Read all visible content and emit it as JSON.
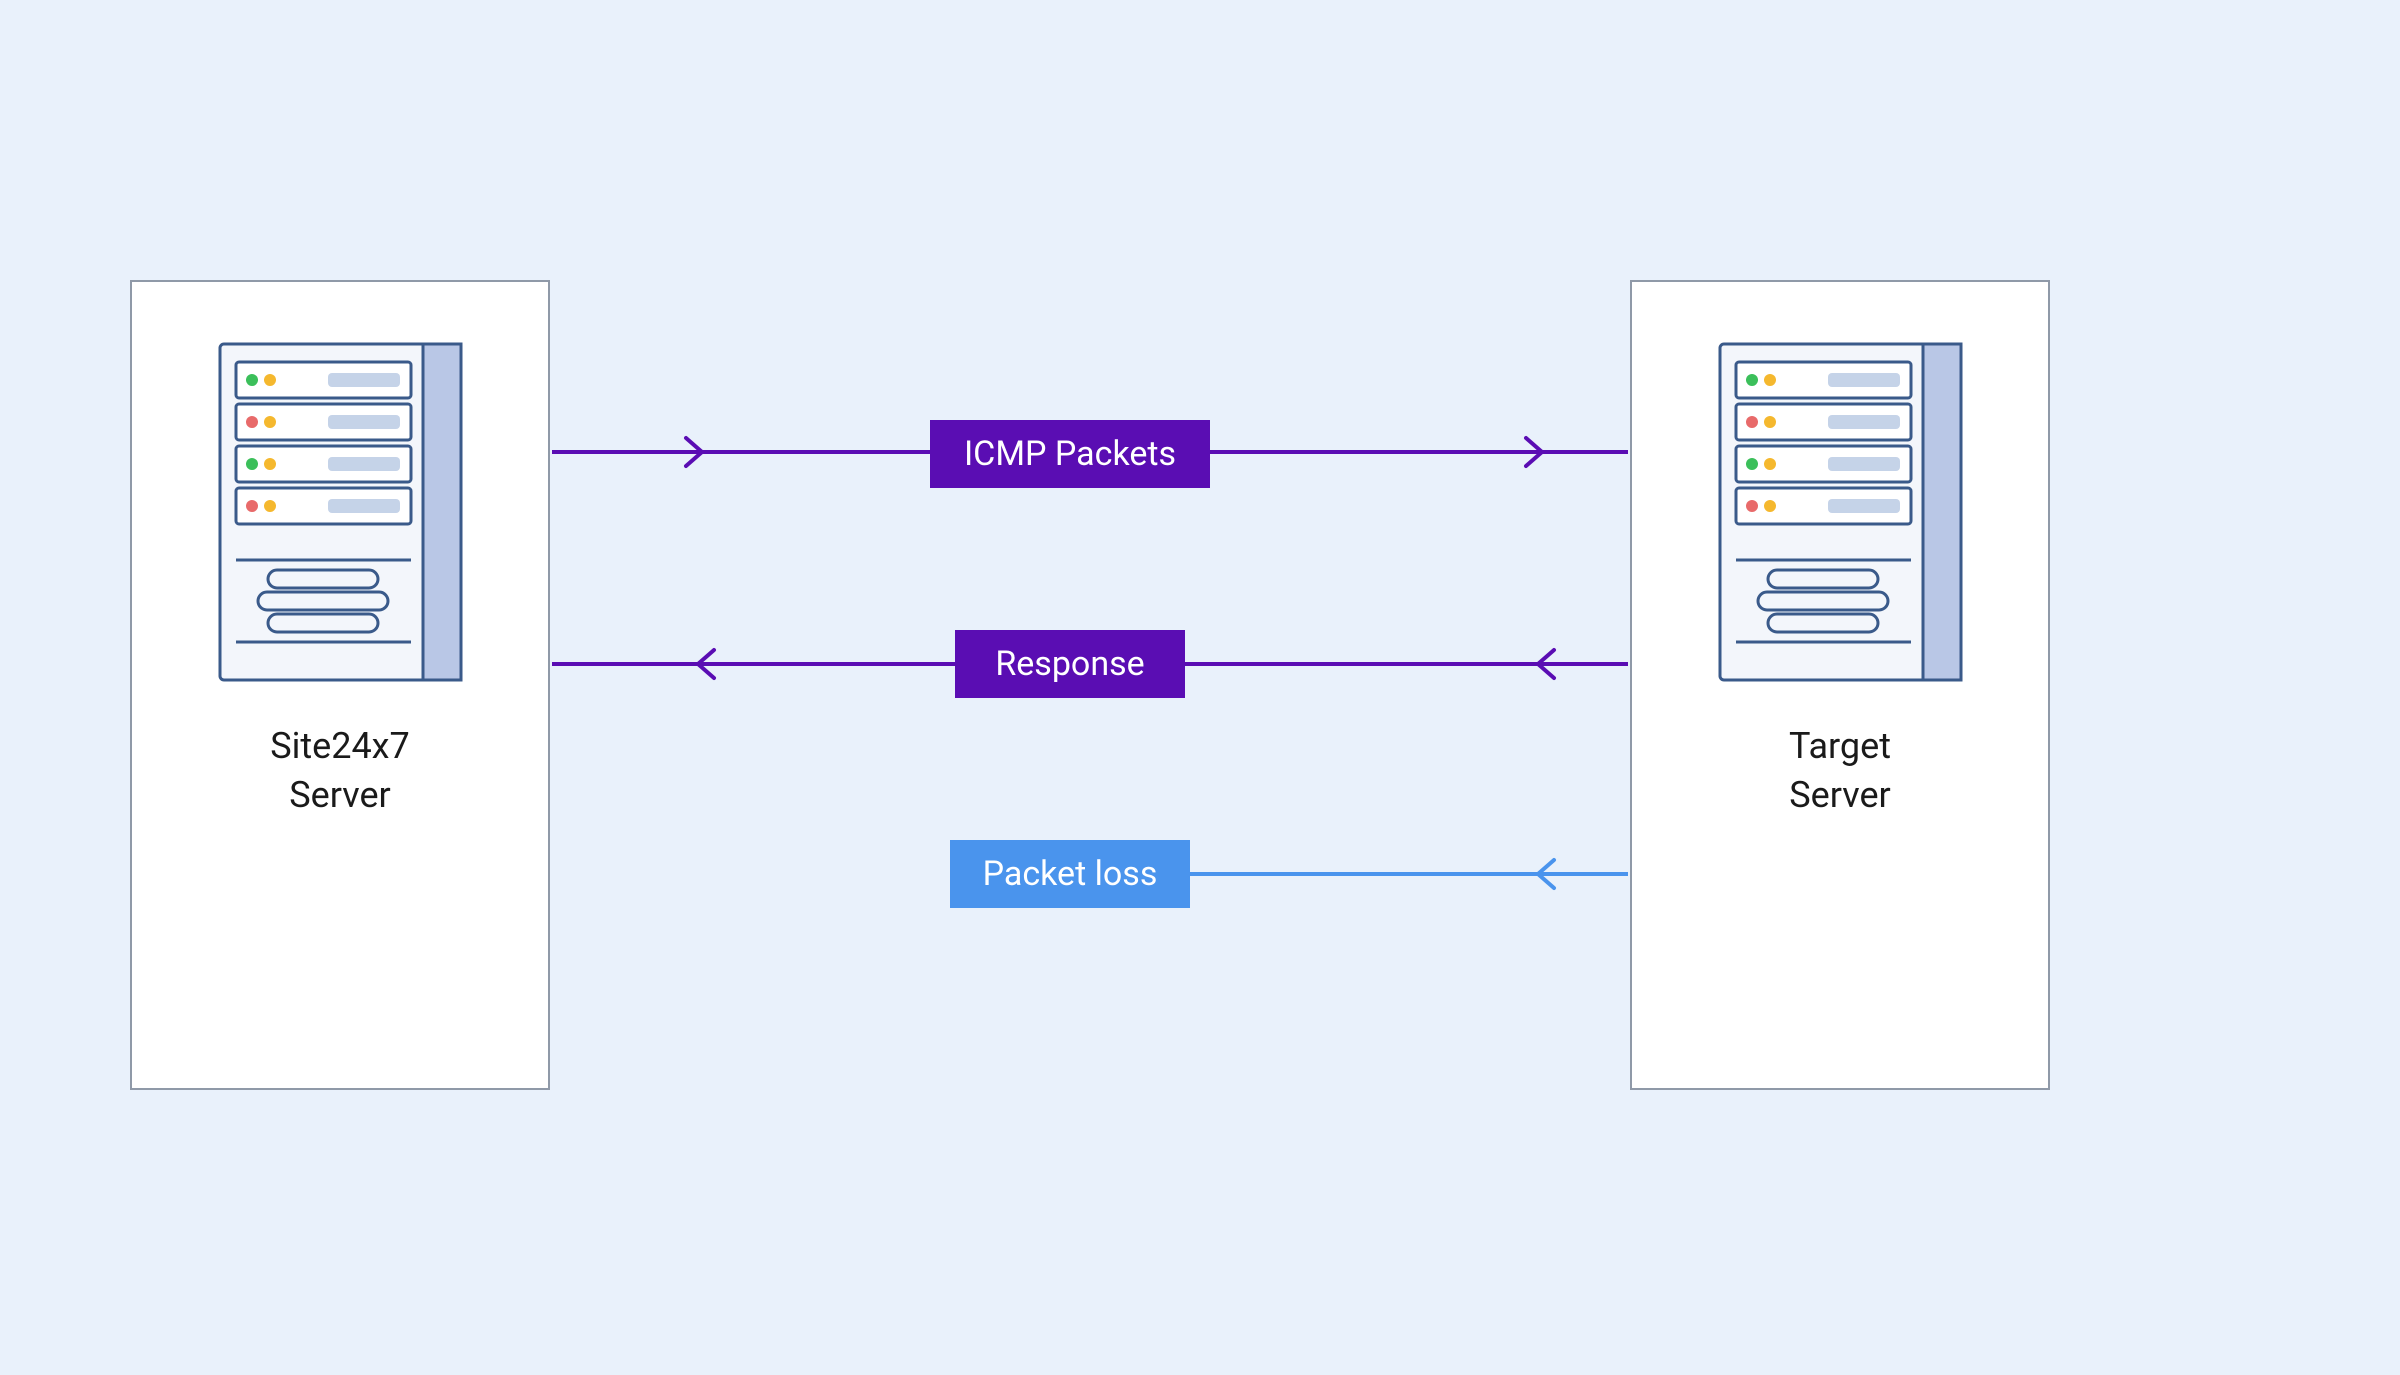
{
  "diagram": {
    "nodes": {
      "left": {
        "label_line1": "Site24x7",
        "label_line2": "Server"
      },
      "right": {
        "label_line1": "Target",
        "label_line2": "Server"
      }
    },
    "flows": {
      "icmp": {
        "label": "ICMP Packets",
        "direction": "right",
        "color": "#5a0db3"
      },
      "resp": {
        "label": "Response",
        "direction": "left",
        "color": "#5a0db3"
      },
      "loss": {
        "label": "Packet loss",
        "direction": "left-partial",
        "color": "#4a94ed"
      }
    }
  },
  "colors": {
    "bg": "#e9f1fb",
    "purple": "#5a0db3",
    "blue": "#4a94ed",
    "boxBorder": "#8f99a8",
    "serverOutline": "#3a5a8a"
  }
}
